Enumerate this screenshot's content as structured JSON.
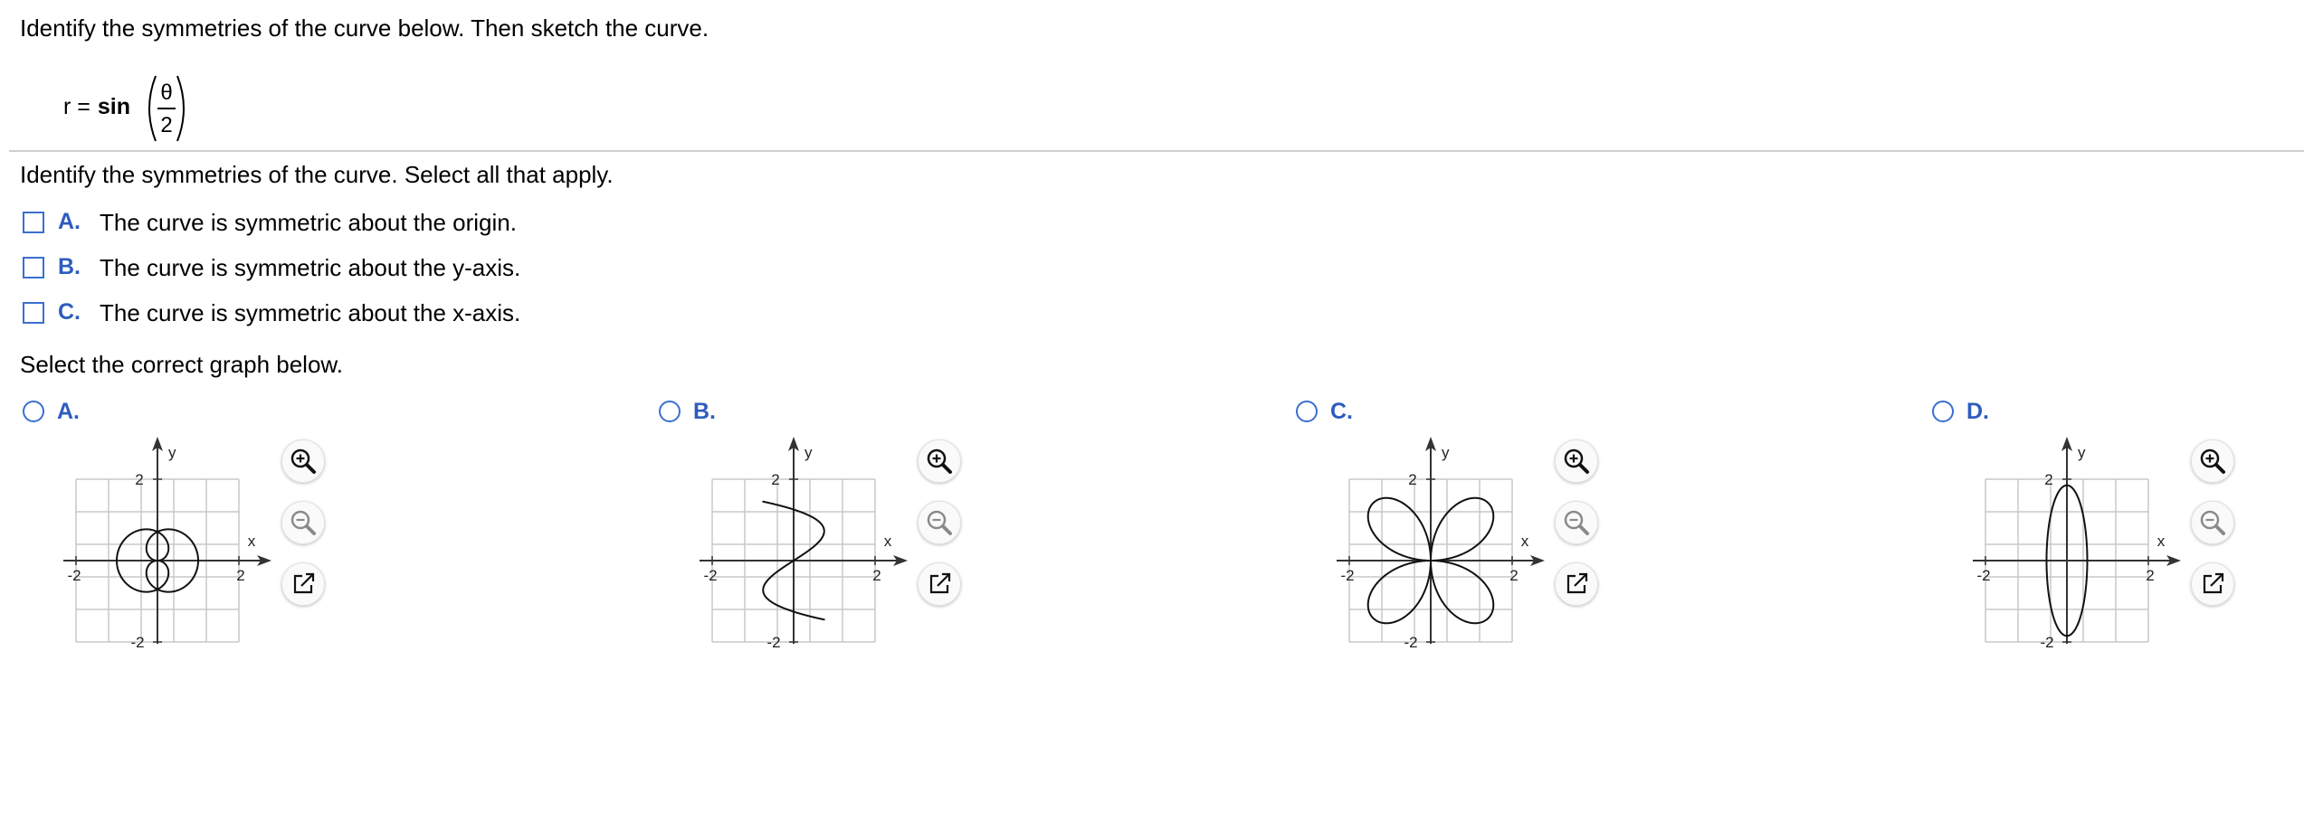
{
  "question": {
    "instruction": "Identify the symmetries of the curve below. Then sketch the curve.",
    "formula": {
      "lhs": "r =",
      "function": "sin",
      "numerator": "θ",
      "denominator": "2"
    }
  },
  "symmetry_part": {
    "prompt": "Identify the symmetries of the curve. Select all that apply.",
    "options": [
      {
        "letter": "A.",
        "text": "The curve is symmetric about the origin."
      },
      {
        "letter": "B.",
        "text": "The curve is symmetric about the y-axis."
      },
      {
        "letter": "C.",
        "text": "The curve is symmetric about the x-axis."
      }
    ]
  },
  "graph_part": {
    "prompt": "Select the correct graph below.",
    "choices": [
      {
        "letter": "A."
      },
      {
        "letter": "B."
      },
      {
        "letter": "C."
      },
      {
        "letter": "D."
      }
    ]
  },
  "axis_labels": {
    "x": "x",
    "y": "y",
    "min": "-2",
    "max": "2",
    "ymax": "2",
    "ymin": "-2"
  },
  "tools": [
    "zoom-in-icon",
    "zoom-out-icon",
    "popout-icon"
  ],
  "colors": {
    "accent": "#2e5cbf",
    "control_border": "#3a6fd0",
    "grid": "#c8c8c8",
    "divider": "#cfcfcf"
  }
}
